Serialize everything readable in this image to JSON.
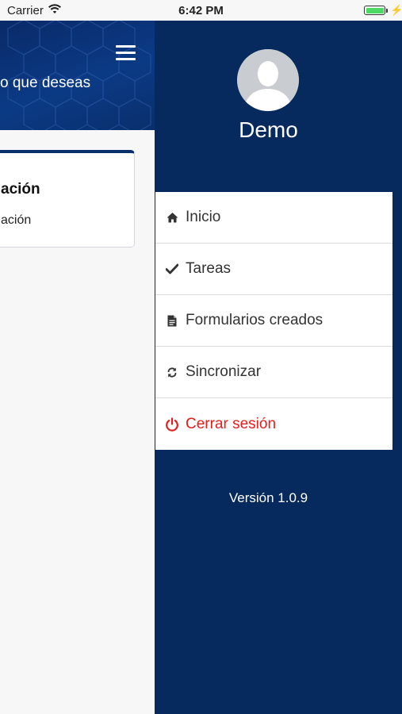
{
  "status_bar": {
    "carrier": "Carrier",
    "time": "6:42 PM"
  },
  "main": {
    "hero_text": "o que deseas",
    "card": {
      "title": "ación",
      "subtitle": "ación"
    }
  },
  "drawer": {
    "user_name": "Demo",
    "menu": [
      {
        "label": "Inicio",
        "icon": "home-icon"
      },
      {
        "label": "Tareas",
        "icon": "check-icon"
      },
      {
        "label": "Formularios creados",
        "icon": "document-icon"
      },
      {
        "label": "Sincronizar",
        "icon": "sync-icon"
      },
      {
        "label": "Cerrar sesión",
        "icon": "power-icon"
      }
    ],
    "version": "Versión 1.0.9"
  },
  "colors": {
    "drawer_bg": "#062a5d",
    "logout_red": "#e41d1d",
    "battery_green": "#4cd964"
  }
}
